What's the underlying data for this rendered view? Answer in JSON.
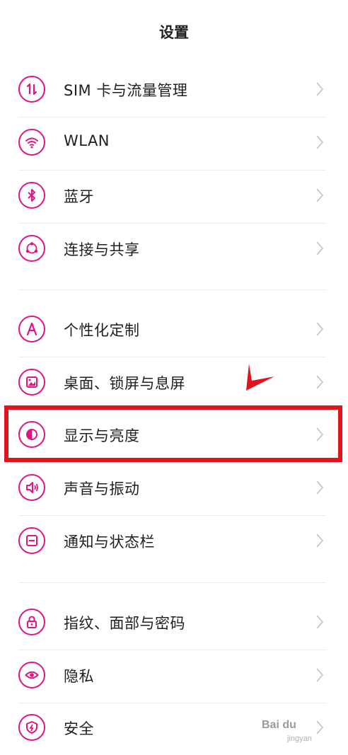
{
  "header": {
    "title": "设置"
  },
  "groups": [
    [
      {
        "label": "SIM 卡与流量管理",
        "icon": "sim-data-icon"
      },
      {
        "label": "WLAN",
        "icon": "wifi-icon"
      },
      {
        "label": "蓝牙",
        "icon": "bluetooth-icon"
      },
      {
        "label": "连接与共享",
        "icon": "share-icon"
      }
    ],
    [
      {
        "label": "个性化定制",
        "icon": "personalize-icon"
      },
      {
        "label": "桌面、锁屏与息屏",
        "icon": "wallpaper-icon"
      },
      {
        "label": "显示与亮度",
        "icon": "display-brightness-icon"
      },
      {
        "label": "声音与振动",
        "icon": "sound-icon"
      },
      {
        "label": "通知与状态栏",
        "icon": "notification-icon"
      }
    ],
    [
      {
        "label": "指纹、面部与密码",
        "icon": "lock-icon"
      },
      {
        "label": "隐私",
        "icon": "privacy-eye-icon"
      },
      {
        "label": "安全",
        "icon": "shield-icon"
      }
    ]
  ],
  "accent_color": "#e0157f",
  "highlight_color": "#e0141d",
  "watermark": {
    "logo_text": "Bai du",
    "sub_text": "jingyan"
  }
}
